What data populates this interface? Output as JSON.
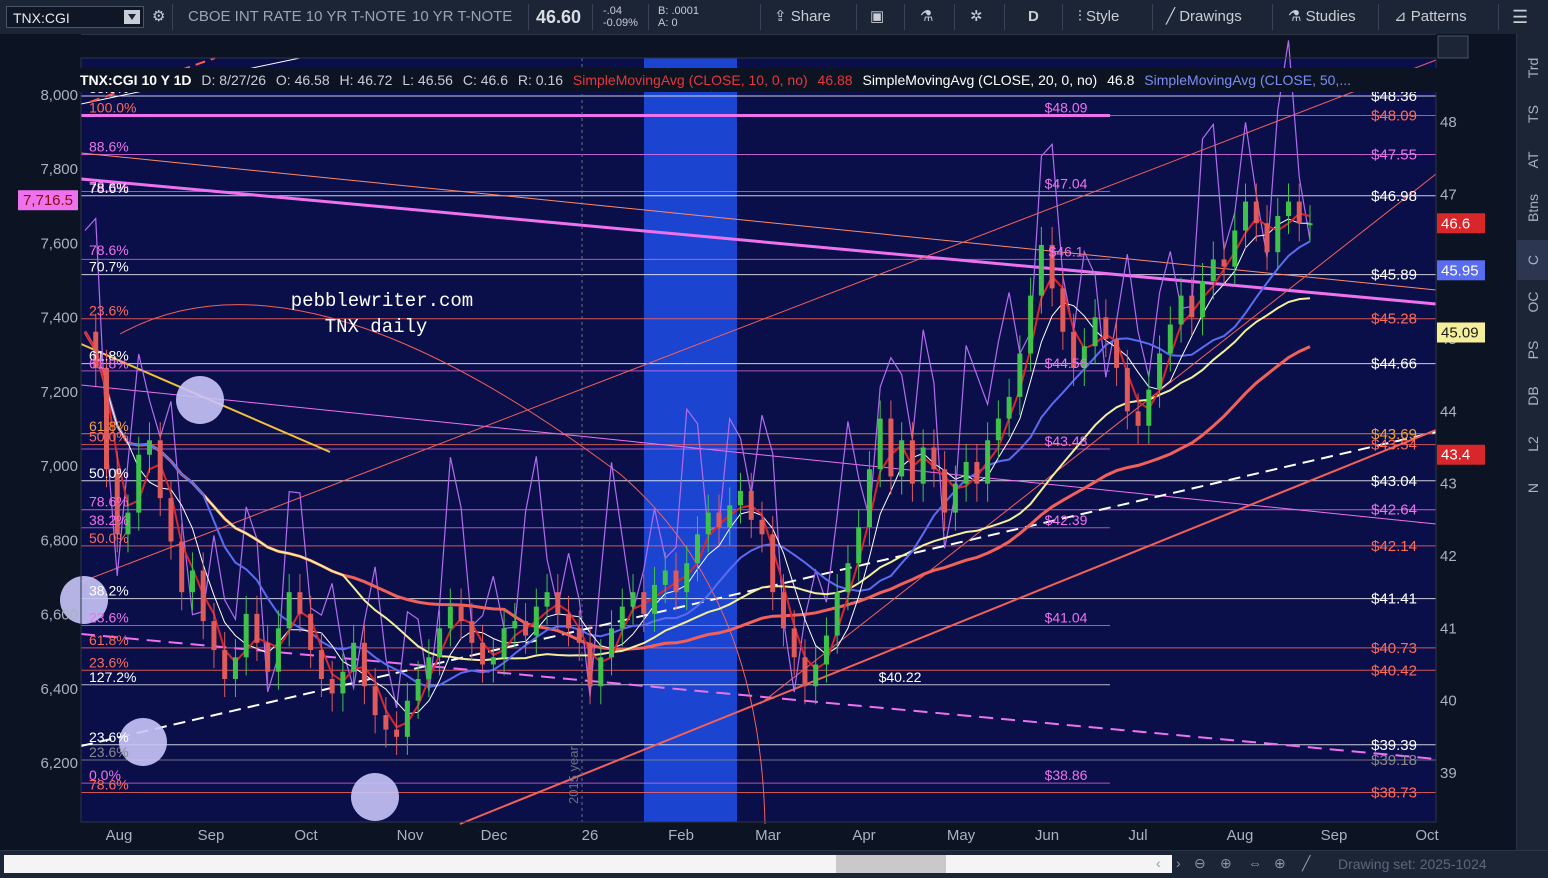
{
  "toolbar": {
    "symbol": "TNX:CGI",
    "description": "CBOE INT RATE 10 YR T-NOTE",
    "short_name": "10 YR T-NOTE",
    "last_price": "46.60",
    "change": "-.04",
    "change_pct": "-0.09%",
    "bid": "B: .0001",
    "ask": "A: 0",
    "share_label": "Share",
    "period_label": "D",
    "style_label": "Style",
    "drawings_label": "Drawings",
    "studies_label": "Studies",
    "patterns_label": "Patterns"
  },
  "status": {
    "title": "TNX:CGI 10 Y 1D",
    "date": "D: 8/27/26",
    "open": "O: 46.58",
    "high": "H: 46.72",
    "low": "L: 46.56",
    "close": "C: 46.6",
    "range": "R: 0.16",
    "sma10": "SimpleMovingAvg (CLOSE, 10, 0, no)",
    "sma10_value": "46.88",
    "sma20": "SimpleMovingAvg (CLOSE, 20, 0, no)",
    "sma20_value": "46.8",
    "sma50": "SimpleMovingAvg (CLOSE, 50,..."
  },
  "side_tabs": [
    "Trd",
    "TS",
    "AT",
    "Btns",
    "C",
    "OC",
    "PS",
    "DB",
    "L2",
    "N"
  ],
  "bottom": {
    "drawing_set": "Drawing set: 2025-1024"
  },
  "colors": {
    "background": "#0c1424",
    "up_candle": "#3ec24a",
    "down_candle": "#e05a5a",
    "sma10": "#d8262b",
    "sma20": "#ffffff",
    "sma50": "#5a6cf0",
    "sma100": "#f4ef9a",
    "sma200": "#f2605a",
    "rsi_overlay": "#b26cf0",
    "fib_magenta": "#ee72ee",
    "highlight_band": "#1f4ee8"
  },
  "annotations": {
    "site": "pebblewriter.com",
    "subtitle": "TNX daily",
    "vertical_label": "2015 year"
  },
  "chart_data": {
    "type": "candlestick",
    "left_axis": {
      "ticks": [
        "8,000",
        "7,800",
        "7,600",
        "7,400",
        "7,200",
        "7,000",
        "6,800",
        "6,600",
        "6,400",
        "6,200"
      ],
      "values": [
        8000,
        7800,
        7600,
        7400,
        7200,
        7000,
        6800,
        6600,
        6400,
        6200
      ],
      "marker": "7,716.5"
    },
    "right_axis": {
      "ticks": [
        "48",
        "47",
        "46",
        "45",
        "44",
        "43",
        "42",
        "41",
        "40",
        "39"
      ],
      "values": [
        48,
        47,
        46,
        45,
        44,
        43,
        42,
        41,
        40,
        39
      ],
      "ylim": [
        38.5,
        48.8
      ]
    },
    "x_labels": [
      "Aug",
      "Sep",
      "Oct",
      "Nov",
      "Dec",
      "26",
      "Feb",
      "Mar",
      "Apr",
      "May",
      "Jun",
      "Jul",
      "Aug",
      "Sep",
      "Oct"
    ],
    "price_tags": [
      {
        "label": "46.6",
        "value": 46.6,
        "color": "#d8262b"
      },
      {
        "label": "45.95",
        "value": 45.95,
        "color": "#5a6cf0"
      },
      {
        "label": "45.09",
        "value": 45.09,
        "color": "#f4ef9a"
      },
      {
        "label": "43.4",
        "value": 43.4,
        "color": "#d8262b"
      }
    ],
    "level_labels_right": [
      {
        "label": "$48.36",
        "value": 48.36,
        "color": "#ffffff"
      },
      {
        "label": "$48.09",
        "value": 48.09,
        "color": "#ff6a5a"
      },
      {
        "label": "$47.55",
        "value": 47.55,
        "color": "#ee72ee"
      },
      {
        "label": "$46.98",
        "value": 46.98,
        "color": "#ffffff"
      },
      {
        "label": "$45.89",
        "value": 45.89,
        "color": "#ffffff"
      },
      {
        "label": "$45.28",
        "value": 45.28,
        "color": "#ff6a5a"
      },
      {
        "label": "$44.66",
        "value": 44.66,
        "color": "#ffffff"
      },
      {
        "label": "$43.69",
        "value": 43.69,
        "color": "#f2a23a"
      },
      {
        "label": "$43.54",
        "value": 43.54,
        "color": "#ff6a5a"
      },
      {
        "label": "$43.04",
        "value": 43.04,
        "color": "#ffffff"
      },
      {
        "label": "$42.64",
        "value": 42.64,
        "color": "#ee72ee"
      },
      {
        "label": "$42.14",
        "value": 42.14,
        "color": "#ff6a5a"
      },
      {
        "label": "$41.41",
        "value": 41.41,
        "color": "#ffffff"
      },
      {
        "label": "$40.73",
        "value": 40.73,
        "color": "#ff6a5a"
      },
      {
        "label": "$40.42",
        "value": 40.42,
        "color": "#ff6a5a"
      },
      {
        "label": "$39.39",
        "value": 39.39,
        "color": "#ffffff"
      },
      {
        "label": "$39.18",
        "value": 39.18,
        "color": "#8a8a8a"
      },
      {
        "label": "$38.73",
        "value": 38.73,
        "color": "#ff6a5a"
      }
    ],
    "level_labels_mid": [
      {
        "label": "$48.09",
        "value": 48.09,
        "color": "#ee72ee"
      },
      {
        "label": "$47.04",
        "value": 47.04,
        "color": "#ee72ee"
      },
      {
        "label": "$46.1",
        "value": 46.1,
        "color": "#ee72ee"
      },
      {
        "label": "$44.56",
        "value": 44.56,
        "color": "#ee72ee"
      },
      {
        "label": "$43.48",
        "value": 43.48,
        "color": "#ee72ee"
      },
      {
        "label": "$42.39",
        "value": 42.39,
        "color": "#ee72ee"
      },
      {
        "label": "$41.04",
        "value": 41.04,
        "color": "#ee72ee"
      },
      {
        "label": "$40.22",
        "value": 40.22,
        "color": "#ffffff"
      },
      {
        "label": "$38.86",
        "value": 38.86,
        "color": "#ee72ee"
      }
    ],
    "fib_labels_left": [
      {
        "label": "88.6%",
        "value": 48.36,
        "color": "#ffffff"
      },
      {
        "label": "100.0%",
        "value": 48.09,
        "color": "#ff6a5a"
      },
      {
        "label": "88.6%",
        "value": 47.55,
        "color": "#ee72ee"
      },
      {
        "label": "78.6%",
        "value": 47.0,
        "color": "#ee72ee"
      },
      {
        "label": "78.6%",
        "value": 46.98,
        "color": "#ffffff"
      },
      {
        "label": "78.6%",
        "value": 46.12,
        "color": "#ee72ee"
      },
      {
        "label": "70.7%",
        "value": 45.89,
        "color": "#ffffff"
      },
      {
        "label": "23.6%",
        "value": 45.28,
        "color": "#ff6a5a"
      },
      {
        "label": "61.8%",
        "value": 44.66,
        "color": "#ffffff"
      },
      {
        "label": "61.8%",
        "value": 44.55,
        "color": "#ee72ee"
      },
      {
        "label": "61.8%",
        "value": 43.69,
        "color": "#f2a23a"
      },
      {
        "label": "50.0%",
        "value": 43.54,
        "color": "#ff6a5a"
      },
      {
        "label": "50.0%",
        "value": 43.04,
        "color": "#ffffff"
      },
      {
        "label": "78.6%",
        "value": 42.64,
        "color": "#ee72ee"
      },
      {
        "label": "38.2%",
        "value": 42.39,
        "color": "#ee72ee"
      },
      {
        "label": "50.0%",
        "value": 42.14,
        "color": "#ff6a5a"
      },
      {
        "label": "38.2%",
        "value": 41.41,
        "color": "#ffffff"
      },
      {
        "label": "23.6%",
        "value": 41.04,
        "color": "#ee72ee"
      },
      {
        "label": "61.8%",
        "value": 40.73,
        "color": "#ff6a5a"
      },
      {
        "label": "23.6%",
        "value": 40.42,
        "color": "#ff6a5a"
      },
      {
        "label": "127.2%",
        "value": 40.22,
        "color": "#ffffff"
      },
      {
        "label": "23.6%",
        "value": 39.39,
        "color": "#ffffff"
      },
      {
        "label": "23.6%",
        "value": 39.18,
        "color": "#8a8a8a"
      },
      {
        "label": "0.0%",
        "value": 38.86,
        "color": "#ee72ee"
      },
      {
        "label": "78.6%",
        "value": 38.73,
        "color": "#ff6a5a"
      }
    ],
    "series": [
      {
        "name": "SMA 10",
        "color": "#d8262b"
      },
      {
        "name": "SMA 20",
        "color": "#ffffff"
      },
      {
        "name": "SMA 50",
        "color": "#5a6cf0"
      }
    ],
    "close_path": [
      45.1,
      44.6,
      43.2,
      42.3,
      42.6,
      43.4,
      43.6,
      42.8,
      42.2,
      41.5,
      41.8,
      41.1,
      40.7,
      40.3,
      40.6,
      41.2,
      40.8,
      40.4,
      41.0,
      41.5,
      41.2,
      40.7,
      40.3,
      40.1,
      40.4,
      40.8,
      40.2,
      39.8,
      39.6,
      39.5,
      40.0,
      40.3,
      40.6,
      41.0,
      41.3,
      41.1,
      40.8,
      40.5,
      40.6,
      41.0,
      41.1,
      40.9,
      41.3,
      41.5,
      41.2,
      41.0,
      40.8,
      40.2,
      40.6,
      41.0,
      41.3,
      41.5,
      41.2,
      41.6,
      41.8,
      41.5,
      41.9,
      42.3,
      42.6,
      42.4,
      42.7,
      42.9,
      42.5,
      42.3,
      41.5,
      41.0,
      40.6,
      40.2,
      40.5,
      40.9,
      41.5,
      41.9,
      42.4,
      43.2,
      43.9,
      43.1,
      43.6,
      43.0,
      43.5,
      43.2,
      42.6,
      43.0,
      43.3,
      43.0,
      43.6,
      43.9,
      44.2,
      44.8,
      45.6,
      46.3,
      45.7,
      45.1,
      44.6,
      44.9,
      45.3,
      45.0,
      44.6,
      44.0,
      43.8,
      44.3,
      44.8,
      45.2,
      45.6,
      45.3,
      45.8,
      46.1,
      46.0,
      46.5,
      46.9,
      46.6,
      46.2,
      46.7,
      46.9,
      46.6,
      46.6
    ],
    "date_range": {
      "start": "Aug",
      "end": "Aug"
    }
  }
}
